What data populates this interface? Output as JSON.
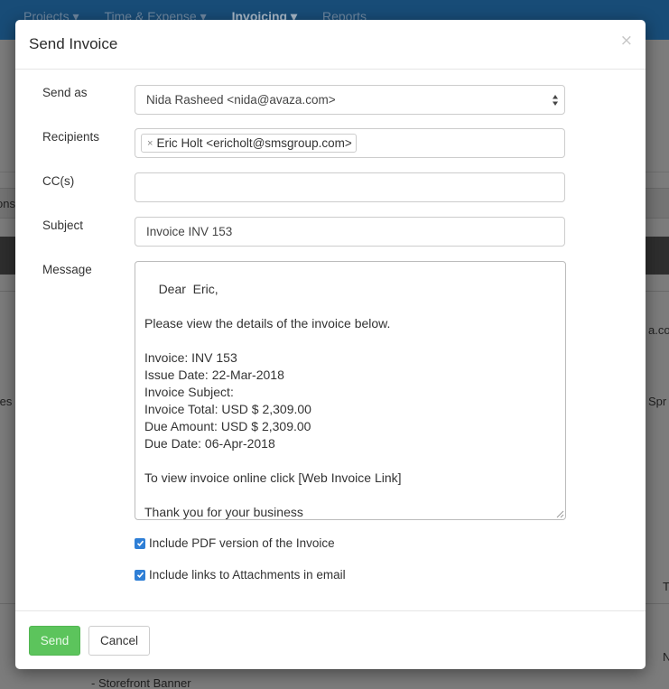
{
  "background": {
    "nav": [
      "Projects ▾",
      "Time & Expense ▾",
      "Invoicing ▾",
      "Reports"
    ],
    "active_nav_index": 2,
    "fragments": {
      "left_1": "ons",
      "left_2": "tes",
      "right_1": "a.com",
      "right_2": "Spr",
      "right_3": "T",
      "right_4": "N",
      "bottom_1": "- Storefront Banner"
    }
  },
  "modal": {
    "title": "Send Invoice",
    "close_icon": "×",
    "fields": {
      "send_as": {
        "label": "Send as",
        "value": "Nida Rasheed <nida@avaza.com>"
      },
      "recipients": {
        "label": "Recipients",
        "tags": [
          "Eric Holt <ericholt@smsgroup.com>"
        ],
        "tag_remove": "×"
      },
      "cc": {
        "label": "CC(s)",
        "value": ""
      },
      "subject": {
        "label": "Subject",
        "value": "Invoice INV 153"
      },
      "message": {
        "label": "Message",
        "value": "Dear  Eric,\n\nPlease view the details of the invoice below.\n\nInvoice: INV 153\nIssue Date: 22-Mar-2018\nInvoice Subject:\nInvoice Total: USD $ 2,309.00\nDue Amount: USD $ 2,309.00\nDue Date: 06-Apr-2018\n\nTo view invoice online click [Web Invoice Link]\n\nThank you for your business\nAcme Incorporated"
      }
    },
    "options": [
      {
        "label": "Include PDF version of the Invoice",
        "checked": true
      },
      {
        "label": "Include links to Attachments in email",
        "checked": true
      }
    ],
    "footer": {
      "send_label": "Send",
      "cancel_label": "Cancel"
    }
  },
  "colors": {
    "nav_bg": "#184c77",
    "send_button": "#5cc45c",
    "checkbox": "#2f7fd6"
  }
}
